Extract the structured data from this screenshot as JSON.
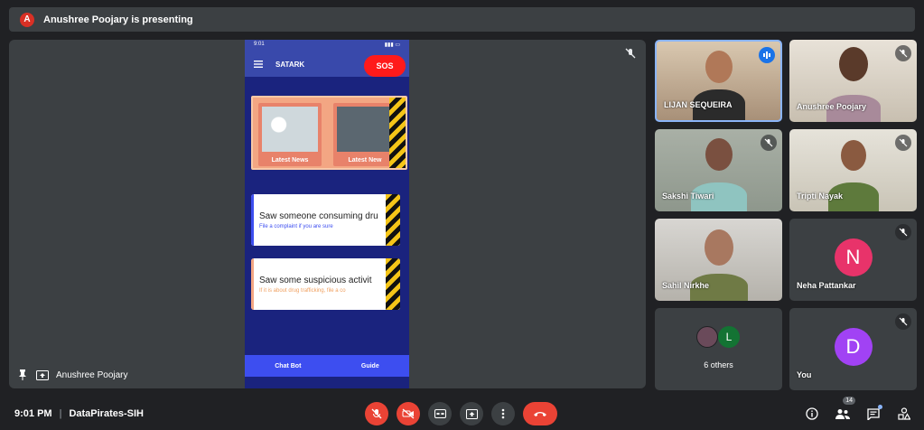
{
  "presenting_banner": {
    "avatar_letter": "A",
    "text": "Anushree Poojary is presenting"
  },
  "main": {
    "presenter_name": "Anushree Poojary",
    "phone": {
      "time": "9:01",
      "app_title": "SATARK",
      "sos_label": "SOS",
      "news_label_1": "Latest News",
      "news_label_2": "Latest New",
      "card1_title": "Saw someone consuming dru",
      "card1_sub": "File a complaint if you are sure",
      "card2_title": "Saw some suspicious activit",
      "card2_sub": "If it is about drug trafficking, file a co",
      "nav_left": "Chat Bot",
      "nav_right": "Guide"
    }
  },
  "participants": [
    {
      "name": "LIJAN SEQUEIRA"
    },
    {
      "name": "Anushree Poojary"
    },
    {
      "name": "Sakshi Tiwari"
    },
    {
      "name": "Tripti Nayak"
    },
    {
      "name": "Sahil Nirkhe"
    },
    {
      "name": "Neha Pattankar",
      "avatar_letter": "N",
      "color": "#e8336a"
    },
    {
      "name": "6 others",
      "avatar_letter": "L"
    },
    {
      "name": "You",
      "avatar_letter": "D",
      "color": "#a142f4"
    }
  ],
  "bottom": {
    "time": "9:01 PM",
    "meeting_name": "DataPirates-SIH",
    "people_count": "14"
  },
  "colors": {
    "end_call": "#ea4335",
    "sos": "#ff1a1a",
    "app_bar": "#3949ab"
  }
}
